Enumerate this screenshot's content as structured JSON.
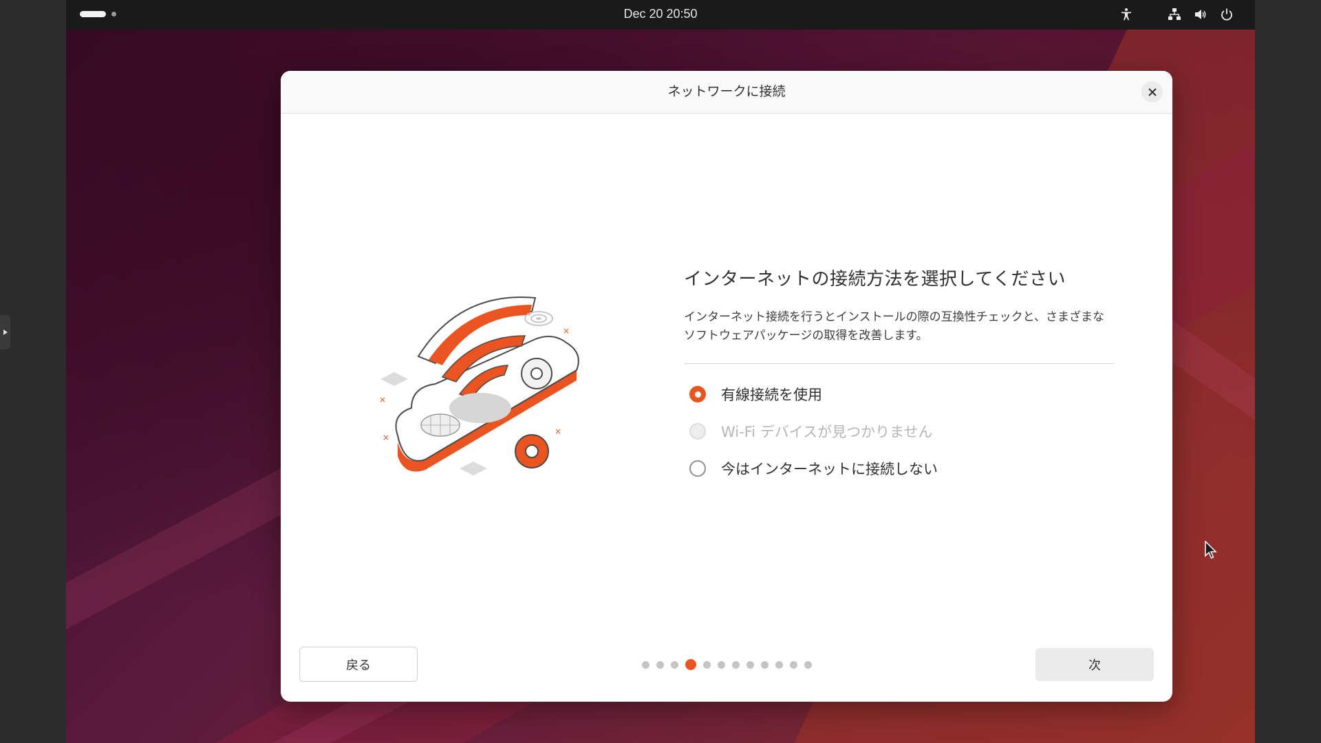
{
  "topbar": {
    "clock": "Dec 20  20:50",
    "tray_icons": [
      "accessibility-icon",
      "network-wired-icon",
      "volume-icon",
      "power-icon"
    ]
  },
  "dialog": {
    "title": "ネットワークに接続",
    "heading": "インターネットの接続方法を選択してください",
    "description": "インターネット接続を行うとインストールの際の互換性チェックと、さまざまなソフトウェアパッケージの取得を改善します。",
    "options": [
      {
        "label": "有線接続を使用",
        "checked": true,
        "disabled": false
      },
      {
        "label": "Wi-Fi デバイスが見つかりません",
        "checked": false,
        "disabled": true
      },
      {
        "label": "今はインターネットに接続しない",
        "checked": false,
        "disabled": false
      }
    ],
    "back_label": "戻る",
    "next_label": "次",
    "pager": {
      "total": 12,
      "current": 4
    }
  },
  "colors": {
    "accent": "#e95420",
    "topbar": "#1a1a1a",
    "dialog_bg": "#ffffff"
  }
}
